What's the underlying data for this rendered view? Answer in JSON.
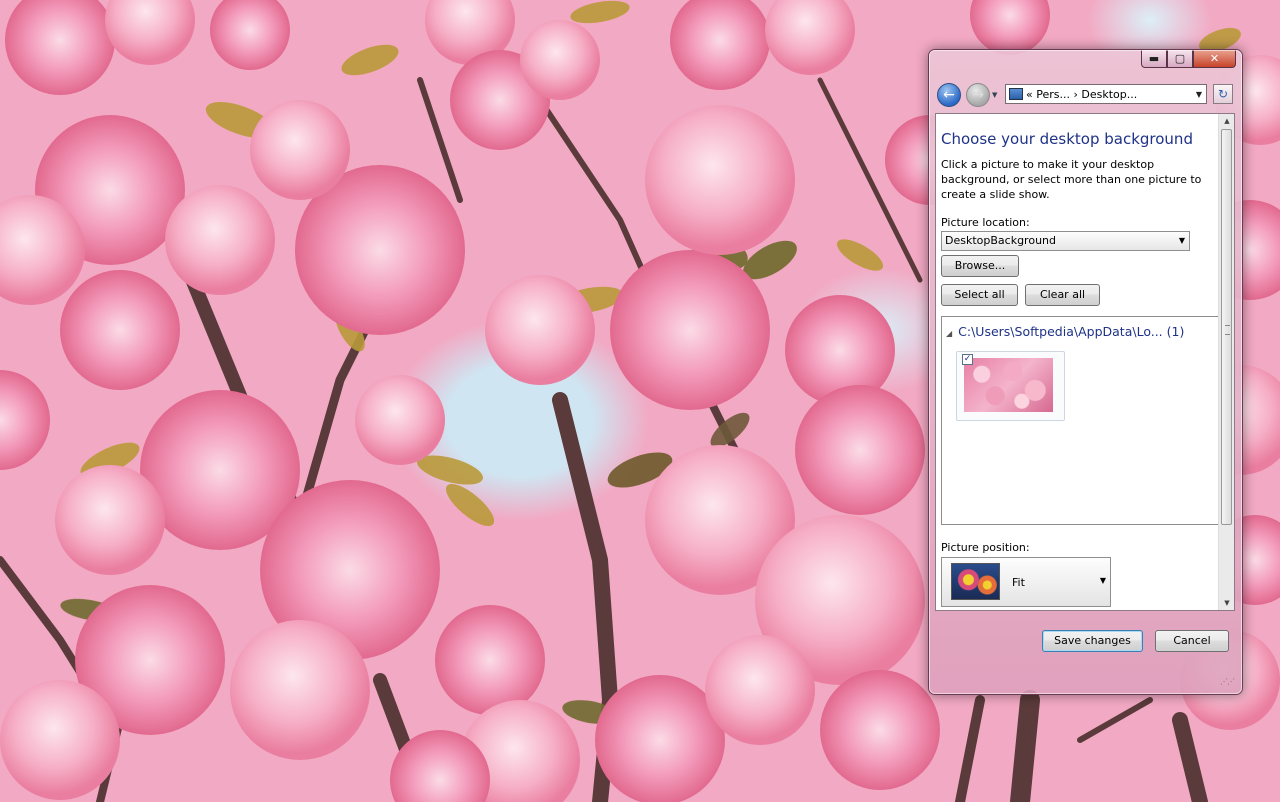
{
  "window": {
    "caption_buttons": {
      "minimize": "▬",
      "maximize": "▢",
      "close": "✕"
    },
    "address": {
      "chevrons": "«",
      "crumbs": "Pers...",
      "separator": "›",
      "current": "Desktop..."
    },
    "heading": "Choose your desktop background",
    "description": "Click a picture to make it your desktop background, or select more than one picture to create a slide show.",
    "picture_location_label": "Picture location:",
    "picture_location_value": "DesktopBackground",
    "browse_label": "Browse...",
    "select_all_label": "Select all",
    "clear_all_label": "Clear all",
    "group_header": "C:\\Users\\Softpedia\\AppData\\Lo... (1)",
    "picture_checked": true,
    "picture_position_label": "Picture position:",
    "picture_position_value": "Fit",
    "save_label": "Save changes",
    "cancel_label": "Cancel"
  },
  "icons": [
    "back-arrow-icon",
    "forward-arrow-icon",
    "control-panel-icon",
    "refresh-icon",
    "dropdown-arrow-icon",
    "checkbox-icon",
    "resize-grip-icon"
  ],
  "colors": {
    "accent_heading": "#1e3287",
    "window_frame": "#e0a8c2",
    "desktop_pink": "#f2a9c3"
  }
}
